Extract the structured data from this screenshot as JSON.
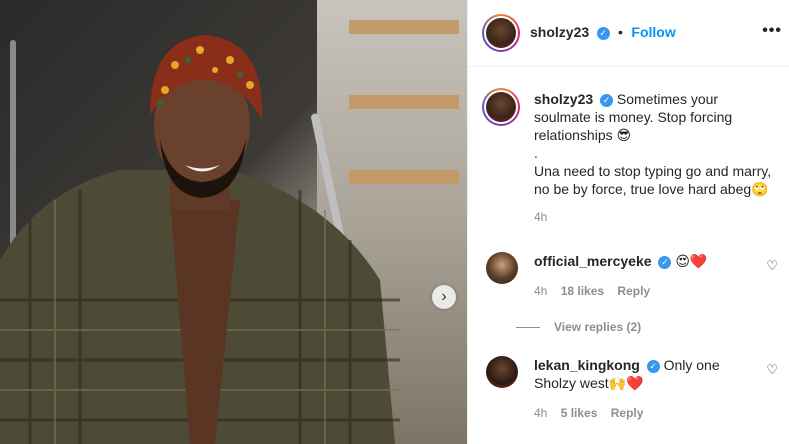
{
  "post": {
    "image_alt": "Man in plaid shirt and patterned headwrap on staircase"
  },
  "header": {
    "username": "sholzy23",
    "separator": "•",
    "follow_label": "Follow",
    "more_label": "•••"
  },
  "caption": {
    "username": "sholzy23",
    "text_line1": "Sometimes your soulmate is money. Stop forcing relationships 😎",
    "text_line2": ".",
    "text_line3": "Una need to stop typing go and marry, no be by force, true love hard abeg🙄",
    "time": "4h"
  },
  "comments": [
    {
      "username": "official_mercyeke",
      "text": "😍❤️",
      "time": "4h",
      "likes": "18 likes",
      "reply_label": "Reply",
      "view_replies": "View replies (2)"
    },
    {
      "username": "lekan_kingkong",
      "text": "Only one Sholzy west🙌❤️",
      "time": "4h",
      "likes": "5 likes",
      "reply_label": "Reply"
    }
  ],
  "icons": {
    "verified": "✓",
    "next_arrow": "›",
    "heart": "♡"
  }
}
